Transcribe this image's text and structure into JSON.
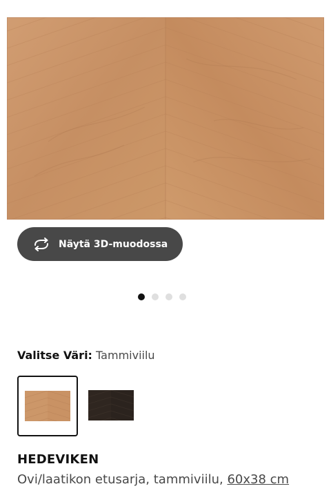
{
  "product_image": {
    "alt_icon": "wood-veneer-herringbone-image"
  },
  "view3d_button": {
    "label": "Näytä 3D-muodossa",
    "icon": "rotate-3d-icon"
  },
  "carousel": {
    "dot_count": 4,
    "active_index": 0
  },
  "color": {
    "label": "Valitse Väri:",
    "value": "Tammiviilu",
    "swatches": [
      {
        "name": "Tammiviilu",
        "color": "#c9956a",
        "selected": true
      },
      {
        "name": "dark",
        "color": "#2f2621",
        "selected": false
      }
    ]
  },
  "product": {
    "name": "HEDEVIKEN",
    "description": "Ovi/laatikon etusarja, tammiviilu,",
    "size": "60x38 cm"
  }
}
